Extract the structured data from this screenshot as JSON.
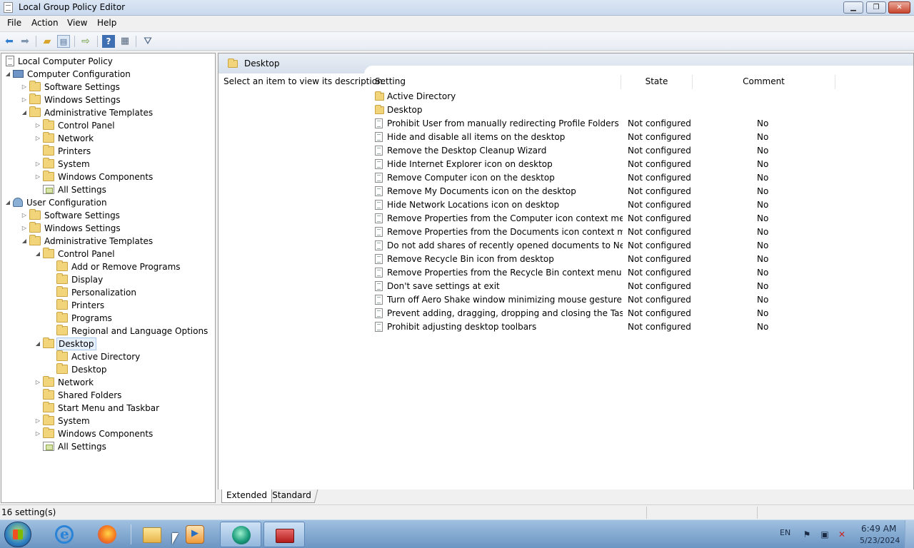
{
  "window": {
    "title": "Local Group Policy Editor"
  },
  "menu": [
    "File",
    "Action",
    "View",
    "Help"
  ],
  "toolbar": {
    "buttons": [
      "back-icon",
      "forward-icon",
      "up-folder-icon",
      "show-hide-console-tree-icon",
      "export-list-icon",
      "help-icon",
      "properties-icon",
      "filter-icon"
    ]
  },
  "tree": [
    {
      "label": "Local Computer Policy",
      "level": 0,
      "icon": "policy-doc",
      "expander": ""
    },
    {
      "label": "Computer Configuration",
      "level": 0,
      "icon": "computer",
      "expander": "open"
    },
    {
      "label": "Software Settings",
      "level": 1,
      "icon": "folder",
      "expander": "closed"
    },
    {
      "label": "Windows Settings",
      "level": 1,
      "icon": "folder",
      "expander": "closed"
    },
    {
      "label": "Administrative Templates",
      "level": 1,
      "icon": "folder",
      "expander": "open"
    },
    {
      "label": "Control Panel",
      "level": 2,
      "icon": "folder",
      "expander": "closed"
    },
    {
      "label": "Network",
      "level": 2,
      "icon": "folder",
      "expander": "closed"
    },
    {
      "label": "Printers",
      "level": 2,
      "icon": "folder",
      "expander": ""
    },
    {
      "label": "System",
      "level": 2,
      "icon": "folder",
      "expander": "closed"
    },
    {
      "label": "Windows Components",
      "level": 2,
      "icon": "folder",
      "expander": "closed"
    },
    {
      "label": "All Settings",
      "level": 2,
      "icon": "all-settings",
      "expander": ""
    },
    {
      "label": "User Configuration",
      "level": 0,
      "icon": "user",
      "expander": "open"
    },
    {
      "label": "Software Settings",
      "level": 1,
      "icon": "folder",
      "expander": "closed"
    },
    {
      "label": "Windows Settings",
      "level": 1,
      "icon": "folder",
      "expander": "closed"
    },
    {
      "label": "Administrative Templates",
      "level": 1,
      "icon": "folder",
      "expander": "open"
    },
    {
      "label": "Control Panel",
      "level": 2,
      "icon": "folder",
      "expander": "open"
    },
    {
      "label": "Add or Remove Programs",
      "level": 3,
      "icon": "folder",
      "expander": ""
    },
    {
      "label": "Display",
      "level": 3,
      "icon": "folder",
      "expander": ""
    },
    {
      "label": "Personalization",
      "level": 3,
      "icon": "folder",
      "expander": ""
    },
    {
      "label": "Printers",
      "level": 3,
      "icon": "folder",
      "expander": ""
    },
    {
      "label": "Programs",
      "level": 3,
      "icon": "folder",
      "expander": ""
    },
    {
      "label": "Regional and Language Options",
      "level": 3,
      "icon": "folder",
      "expander": ""
    },
    {
      "label": "Desktop",
      "level": 2,
      "icon": "folder",
      "expander": "open",
      "selected": true
    },
    {
      "label": "Active Directory",
      "level": 3,
      "icon": "folder",
      "expander": ""
    },
    {
      "label": "Desktop",
      "level": 3,
      "icon": "folder",
      "expander": ""
    },
    {
      "label": "Network",
      "level": 2,
      "icon": "folder",
      "expander": "closed"
    },
    {
      "label": "Shared Folders",
      "level": 2,
      "icon": "folder",
      "expander": ""
    },
    {
      "label": "Start Menu and Taskbar",
      "level": 2,
      "icon": "folder",
      "expander": ""
    },
    {
      "label": "System",
      "level": 2,
      "icon": "folder",
      "expander": "closed"
    },
    {
      "label": "Windows Components",
      "level": 2,
      "icon": "folder",
      "expander": "closed"
    },
    {
      "label": "All Settings",
      "level": 2,
      "icon": "all-settings",
      "expander": ""
    }
  ],
  "right_pane": {
    "header_title": "Desktop",
    "description_prompt": "Select an item to view its description.",
    "columns": {
      "setting": "Setting",
      "state": "State",
      "comment": "Comment"
    },
    "rows": [
      {
        "type": "folder",
        "setting": "Active Directory",
        "state": "",
        "comment": ""
      },
      {
        "type": "folder",
        "setting": "Desktop",
        "state": "",
        "comment": ""
      },
      {
        "type": "policy",
        "setting": "Prohibit User from manually redirecting Profile Folders",
        "state": "Not configured",
        "comment": "No"
      },
      {
        "type": "policy",
        "setting": "Hide and disable all items on the desktop",
        "state": "Not configured",
        "comment": "No"
      },
      {
        "type": "policy",
        "setting": "Remove the Desktop Cleanup Wizard",
        "state": "Not configured",
        "comment": "No"
      },
      {
        "type": "policy",
        "setting": "Hide Internet Explorer icon on desktop",
        "state": "Not configured",
        "comment": "No"
      },
      {
        "type": "policy",
        "setting": "Remove Computer icon on the desktop",
        "state": "Not configured",
        "comment": "No"
      },
      {
        "type": "policy",
        "setting": "Remove My Documents icon on the desktop",
        "state": "Not configured",
        "comment": "No"
      },
      {
        "type": "policy",
        "setting": "Hide Network Locations icon on desktop",
        "state": "Not configured",
        "comment": "No"
      },
      {
        "type": "policy",
        "setting": "Remove Properties from the Computer icon context menu",
        "state": "Not configured",
        "comment": "No"
      },
      {
        "type": "policy",
        "setting": "Remove Properties from the Documents icon context menu",
        "state": "Not configured",
        "comment": "No"
      },
      {
        "type": "policy",
        "setting": "Do not add shares of recently opened documents to Networ...",
        "state": "Not configured",
        "comment": "No"
      },
      {
        "type": "policy",
        "setting": "Remove Recycle Bin icon from desktop",
        "state": "Not configured",
        "comment": "No"
      },
      {
        "type": "policy",
        "setting": "Remove Properties from the Recycle Bin context menu",
        "state": "Not configured",
        "comment": "No"
      },
      {
        "type": "policy",
        "setting": "Don't save settings at exit",
        "state": "Not configured",
        "comment": "No"
      },
      {
        "type": "policy",
        "setting": "Turn off Aero Shake window minimizing mouse gesture",
        "state": "Not configured",
        "comment": "No"
      },
      {
        "type": "policy",
        "setting": "Prevent adding, dragging, dropping and closing the Taskbar...",
        "state": "Not configured",
        "comment": "No"
      },
      {
        "type": "policy",
        "setting": "Prohibit adjusting desktop toolbars",
        "state": "Not configured",
        "comment": "No"
      }
    ]
  },
  "view_tabs": {
    "extended": "Extended",
    "standard": "Standard"
  },
  "status_bar": {
    "text": "16 setting(s)"
  },
  "taskbar": {
    "pinned": [
      "internet-explorer-icon",
      "firefox-icon",
      "windows-explorer-icon",
      "media-player-icon",
      "network-app-icon",
      "toolbox-app-icon"
    ],
    "tray": {
      "language": "EN",
      "time": "6:49 AM",
      "date": "5/23/2024"
    }
  }
}
